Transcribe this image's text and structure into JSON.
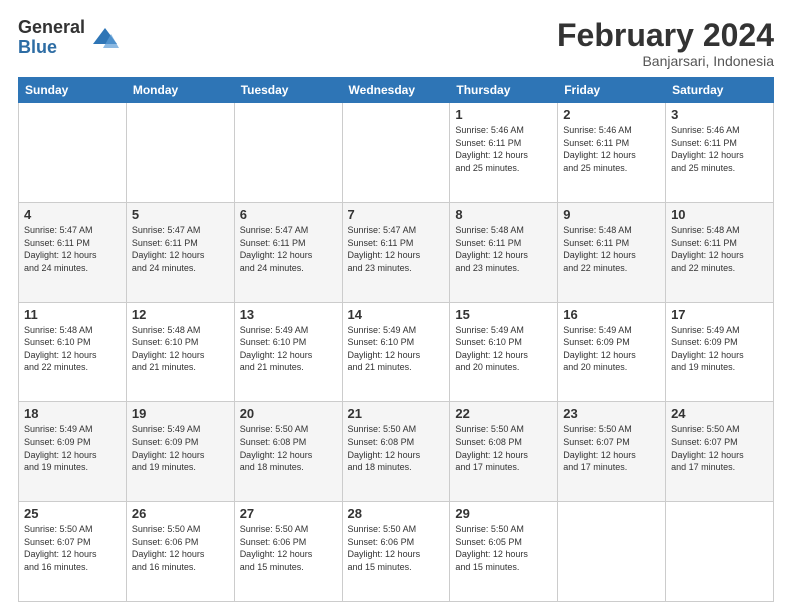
{
  "header": {
    "logo_general": "General",
    "logo_blue": "Blue",
    "month_title": "February 2024",
    "location": "Banjarsari, Indonesia"
  },
  "days_of_week": [
    "Sunday",
    "Monday",
    "Tuesday",
    "Wednesday",
    "Thursday",
    "Friday",
    "Saturday"
  ],
  "weeks": [
    [
      {
        "day": "",
        "info": ""
      },
      {
        "day": "",
        "info": ""
      },
      {
        "day": "",
        "info": ""
      },
      {
        "day": "",
        "info": ""
      },
      {
        "day": "1",
        "info": "Sunrise: 5:46 AM\nSunset: 6:11 PM\nDaylight: 12 hours\nand 25 minutes."
      },
      {
        "day": "2",
        "info": "Sunrise: 5:46 AM\nSunset: 6:11 PM\nDaylight: 12 hours\nand 25 minutes."
      },
      {
        "day": "3",
        "info": "Sunrise: 5:46 AM\nSunset: 6:11 PM\nDaylight: 12 hours\nand 25 minutes."
      }
    ],
    [
      {
        "day": "4",
        "info": "Sunrise: 5:47 AM\nSunset: 6:11 PM\nDaylight: 12 hours\nand 24 minutes."
      },
      {
        "day": "5",
        "info": "Sunrise: 5:47 AM\nSunset: 6:11 PM\nDaylight: 12 hours\nand 24 minutes."
      },
      {
        "day": "6",
        "info": "Sunrise: 5:47 AM\nSunset: 6:11 PM\nDaylight: 12 hours\nand 24 minutes."
      },
      {
        "day": "7",
        "info": "Sunrise: 5:47 AM\nSunset: 6:11 PM\nDaylight: 12 hours\nand 23 minutes."
      },
      {
        "day": "8",
        "info": "Sunrise: 5:48 AM\nSunset: 6:11 PM\nDaylight: 12 hours\nand 23 minutes."
      },
      {
        "day": "9",
        "info": "Sunrise: 5:48 AM\nSunset: 6:11 PM\nDaylight: 12 hours\nand 22 minutes."
      },
      {
        "day": "10",
        "info": "Sunrise: 5:48 AM\nSunset: 6:11 PM\nDaylight: 12 hours\nand 22 minutes."
      }
    ],
    [
      {
        "day": "11",
        "info": "Sunrise: 5:48 AM\nSunset: 6:10 PM\nDaylight: 12 hours\nand 22 minutes."
      },
      {
        "day": "12",
        "info": "Sunrise: 5:48 AM\nSunset: 6:10 PM\nDaylight: 12 hours\nand 21 minutes."
      },
      {
        "day": "13",
        "info": "Sunrise: 5:49 AM\nSunset: 6:10 PM\nDaylight: 12 hours\nand 21 minutes."
      },
      {
        "day": "14",
        "info": "Sunrise: 5:49 AM\nSunset: 6:10 PM\nDaylight: 12 hours\nand 21 minutes."
      },
      {
        "day": "15",
        "info": "Sunrise: 5:49 AM\nSunset: 6:10 PM\nDaylight: 12 hours\nand 20 minutes."
      },
      {
        "day": "16",
        "info": "Sunrise: 5:49 AM\nSunset: 6:09 PM\nDaylight: 12 hours\nand 20 minutes."
      },
      {
        "day": "17",
        "info": "Sunrise: 5:49 AM\nSunset: 6:09 PM\nDaylight: 12 hours\nand 19 minutes."
      }
    ],
    [
      {
        "day": "18",
        "info": "Sunrise: 5:49 AM\nSunset: 6:09 PM\nDaylight: 12 hours\nand 19 minutes."
      },
      {
        "day": "19",
        "info": "Sunrise: 5:49 AM\nSunset: 6:09 PM\nDaylight: 12 hours\nand 19 minutes."
      },
      {
        "day": "20",
        "info": "Sunrise: 5:50 AM\nSunset: 6:08 PM\nDaylight: 12 hours\nand 18 minutes."
      },
      {
        "day": "21",
        "info": "Sunrise: 5:50 AM\nSunset: 6:08 PM\nDaylight: 12 hours\nand 18 minutes."
      },
      {
        "day": "22",
        "info": "Sunrise: 5:50 AM\nSunset: 6:08 PM\nDaylight: 12 hours\nand 17 minutes."
      },
      {
        "day": "23",
        "info": "Sunrise: 5:50 AM\nSunset: 6:07 PM\nDaylight: 12 hours\nand 17 minutes."
      },
      {
        "day": "24",
        "info": "Sunrise: 5:50 AM\nSunset: 6:07 PM\nDaylight: 12 hours\nand 17 minutes."
      }
    ],
    [
      {
        "day": "25",
        "info": "Sunrise: 5:50 AM\nSunset: 6:07 PM\nDaylight: 12 hours\nand 16 minutes."
      },
      {
        "day": "26",
        "info": "Sunrise: 5:50 AM\nSunset: 6:06 PM\nDaylight: 12 hours\nand 16 minutes."
      },
      {
        "day": "27",
        "info": "Sunrise: 5:50 AM\nSunset: 6:06 PM\nDaylight: 12 hours\nand 15 minutes."
      },
      {
        "day": "28",
        "info": "Sunrise: 5:50 AM\nSunset: 6:06 PM\nDaylight: 12 hours\nand 15 minutes."
      },
      {
        "day": "29",
        "info": "Sunrise: 5:50 AM\nSunset: 6:05 PM\nDaylight: 12 hours\nand 15 minutes."
      },
      {
        "day": "",
        "info": ""
      },
      {
        "day": "",
        "info": ""
      }
    ]
  ]
}
